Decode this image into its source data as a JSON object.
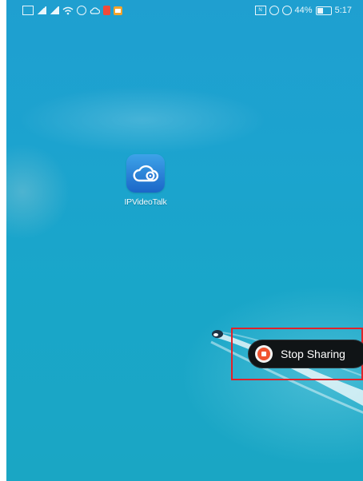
{
  "status_bar": {
    "left_icons": [
      "hd-icon",
      "signal-icon",
      "signal-icon",
      "wifi-icon",
      "sync-icon",
      "cloud-icon",
      "notification-red-icon",
      "notification-orange-icon"
    ],
    "nfc_label": "N",
    "battery_percent_label": "44%",
    "battery_fraction": 0.44,
    "time": "5:17"
  },
  "home": {
    "app_label": "IPVideoTalk",
    "app_icon": "cloud-camera-icon"
  },
  "overlay": {
    "stop_sharing_label": "Stop Sharing",
    "stop_icon": "stop-record-icon",
    "highlight_color": "#e0222a",
    "button_color": "#101416",
    "stop_icon_color": "#f0532f"
  },
  "wallpaper": {
    "colors": [
      "#1f9fd0",
      "#1aa6c4"
    ]
  }
}
